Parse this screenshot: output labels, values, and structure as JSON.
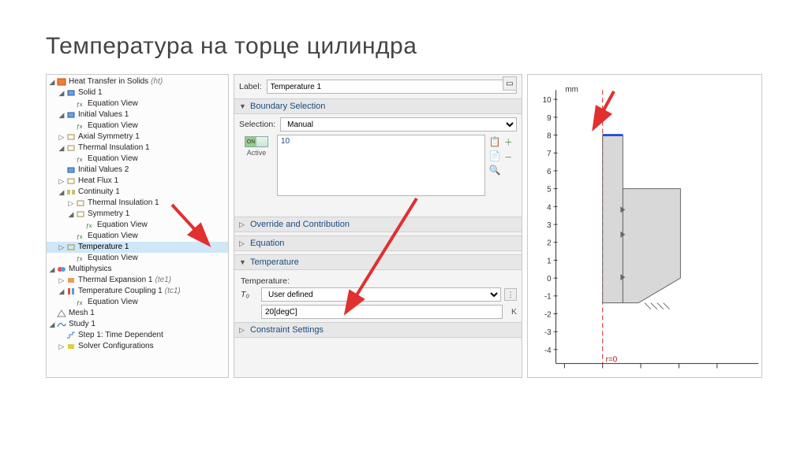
{
  "title": "Температура на торце цилиндра",
  "tree": {
    "heat_transfer": "Heat Transfer in Solids",
    "heat_transfer_tag": "(ht)",
    "solid1": "Solid 1",
    "eq_view": "Equation View",
    "initial_values1": "Initial Values 1",
    "axial_symmetry1": "Axial Symmetry 1",
    "thermal_insulation1": "Thermal Insulation 1",
    "initial_values2": "Initial Values 2",
    "heat_flux1": "Heat Flux 1",
    "continuity1": "Continuity 1",
    "thermal_insulation1b": "Thermal Insulation 1",
    "symmetry1": "Symmetry 1",
    "temperature1": "Temperature 1",
    "multiphysics": "Multiphysics",
    "thermal_expansion1": "Thermal Expansion 1",
    "thermal_expansion1_tag": "(te1)",
    "temperature_coupling1": "Temperature Coupling 1",
    "temperature_coupling1_tag": "(tc1)",
    "mesh1": "Mesh 1",
    "study1": "Study 1",
    "step1": "Step 1: Time Dependent",
    "solver_config": "Solver Configurations"
  },
  "settings": {
    "label_label": "Label:",
    "label_value": "Temperature 1",
    "boundary_selection": "Boundary Selection",
    "selection_label": "Selection:",
    "selection_value": "Manual",
    "selected_ids": "10",
    "on": "ON",
    "active": "Active",
    "override": "Override and Contribution",
    "equation": "Equation",
    "temperature_section": "Temperature",
    "temperature_label": "Temperature:",
    "t0_sym": "T₀",
    "t0_type": "User defined",
    "t0_expr": "20[degC]",
    "t0_unit": "K",
    "constraint": "Constraint Settings"
  },
  "gfx": {
    "unit": "mm",
    "axis_label": "r=0",
    "ticks": [
      "10",
      "9",
      "8",
      "7",
      "6",
      "5",
      "4",
      "3",
      "2",
      "1",
      "0",
      "-1",
      "-2",
      "-3",
      "-4"
    ]
  }
}
